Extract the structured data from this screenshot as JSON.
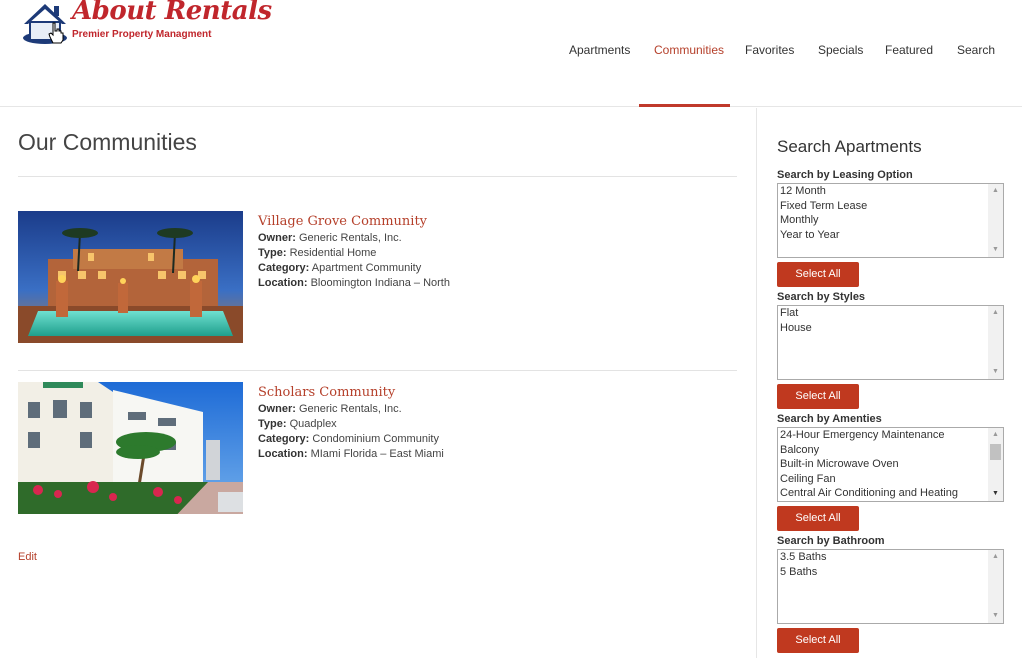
{
  "brand": {
    "title": "About Rentals",
    "subtitle": "Premier Property Managment"
  },
  "nav": {
    "items": [
      {
        "label": "Apartments"
      },
      {
        "label": "Communities"
      },
      {
        "label": "Favorites"
      },
      {
        "label": "Specials"
      },
      {
        "label": "Featured"
      },
      {
        "label": "Search"
      }
    ],
    "active_index": 1
  },
  "main": {
    "title": "Our Communities",
    "communities": [
      {
        "name": "Village Grove Community",
        "owner_label": "Owner:",
        "owner": "Generic Rentals, Inc.",
        "type_label": "Type:",
        "type": "Residential Home",
        "category_label": "Category:",
        "category": "Apartment Community",
        "location_label": "Location:",
        "location": "Bloomington Indiana – North"
      },
      {
        "name": "Scholars Community",
        "owner_label": "Owner:",
        "owner": "Generic Rentals, Inc.",
        "type_label": "Type:",
        "type": "Quadplex",
        "category_label": "Category:",
        "category": "Condominium Community",
        "location_label": "Location:",
        "location": "MIami Florida – East Miami"
      }
    ],
    "edit_label": "Edit"
  },
  "sidebar": {
    "title": "Search Apartments",
    "select_all_label": "Select All",
    "filters": [
      {
        "label": "Search by Leasing Option",
        "options": [
          "12 Month",
          "Fixed Term Lease",
          "Monthly",
          "Year to Year"
        ]
      },
      {
        "label": "Search by Styles",
        "options": [
          "Flat",
          "House"
        ]
      },
      {
        "label": "Search by Amenties",
        "options": [
          "24-Hour Emergency Maintenance",
          "Balcony",
          "Built-in Microwave Oven",
          "Ceiling Fan",
          "Central Air Conditioning and Heating"
        ]
      },
      {
        "label": "Search by Bathroom",
        "options": [
          "3.5 Baths",
          "5 Baths"
        ]
      }
    ]
  },
  "colors": {
    "accent": "#c0392b",
    "link": "#b5402b",
    "button": "#c0391f"
  },
  "icons": [
    "house-logo-icon",
    "hand-cursor-icon",
    "scroll-up-icon",
    "scroll-down-icon"
  ]
}
